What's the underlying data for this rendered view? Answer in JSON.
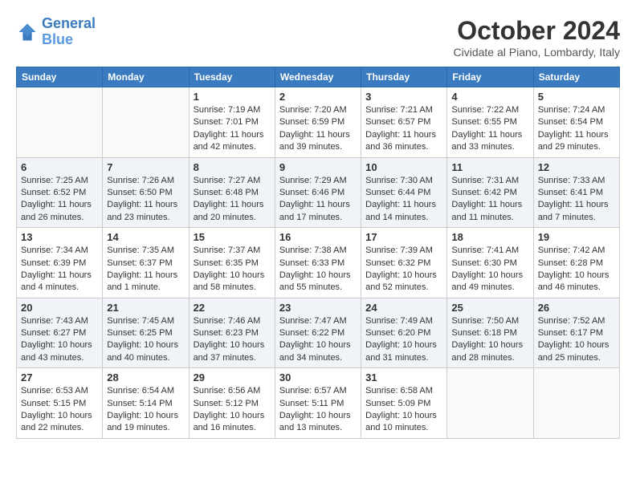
{
  "logo": {
    "line1": "General",
    "line2": "Blue"
  },
  "title": "October 2024",
  "subtitle": "Cividate al Piano, Lombardy, Italy",
  "headers": [
    "Sunday",
    "Monday",
    "Tuesday",
    "Wednesday",
    "Thursday",
    "Friday",
    "Saturday"
  ],
  "weeks": [
    [
      {
        "day": "",
        "info": ""
      },
      {
        "day": "",
        "info": ""
      },
      {
        "day": "1",
        "info": "Sunrise: 7:19 AM\nSunset: 7:01 PM\nDaylight: 11 hours and 42 minutes."
      },
      {
        "day": "2",
        "info": "Sunrise: 7:20 AM\nSunset: 6:59 PM\nDaylight: 11 hours and 39 minutes."
      },
      {
        "day": "3",
        "info": "Sunrise: 7:21 AM\nSunset: 6:57 PM\nDaylight: 11 hours and 36 minutes."
      },
      {
        "day": "4",
        "info": "Sunrise: 7:22 AM\nSunset: 6:55 PM\nDaylight: 11 hours and 33 minutes."
      },
      {
        "day": "5",
        "info": "Sunrise: 7:24 AM\nSunset: 6:54 PM\nDaylight: 11 hours and 29 minutes."
      }
    ],
    [
      {
        "day": "6",
        "info": "Sunrise: 7:25 AM\nSunset: 6:52 PM\nDaylight: 11 hours and 26 minutes."
      },
      {
        "day": "7",
        "info": "Sunrise: 7:26 AM\nSunset: 6:50 PM\nDaylight: 11 hours and 23 minutes."
      },
      {
        "day": "8",
        "info": "Sunrise: 7:27 AM\nSunset: 6:48 PM\nDaylight: 11 hours and 20 minutes."
      },
      {
        "day": "9",
        "info": "Sunrise: 7:29 AM\nSunset: 6:46 PM\nDaylight: 11 hours and 17 minutes."
      },
      {
        "day": "10",
        "info": "Sunrise: 7:30 AM\nSunset: 6:44 PM\nDaylight: 11 hours and 14 minutes."
      },
      {
        "day": "11",
        "info": "Sunrise: 7:31 AM\nSunset: 6:42 PM\nDaylight: 11 hours and 11 minutes."
      },
      {
        "day": "12",
        "info": "Sunrise: 7:33 AM\nSunset: 6:41 PM\nDaylight: 11 hours and 7 minutes."
      }
    ],
    [
      {
        "day": "13",
        "info": "Sunrise: 7:34 AM\nSunset: 6:39 PM\nDaylight: 11 hours and 4 minutes."
      },
      {
        "day": "14",
        "info": "Sunrise: 7:35 AM\nSunset: 6:37 PM\nDaylight: 11 hours and 1 minute."
      },
      {
        "day": "15",
        "info": "Sunrise: 7:37 AM\nSunset: 6:35 PM\nDaylight: 10 hours and 58 minutes."
      },
      {
        "day": "16",
        "info": "Sunrise: 7:38 AM\nSunset: 6:33 PM\nDaylight: 10 hours and 55 minutes."
      },
      {
        "day": "17",
        "info": "Sunrise: 7:39 AM\nSunset: 6:32 PM\nDaylight: 10 hours and 52 minutes."
      },
      {
        "day": "18",
        "info": "Sunrise: 7:41 AM\nSunset: 6:30 PM\nDaylight: 10 hours and 49 minutes."
      },
      {
        "day": "19",
        "info": "Sunrise: 7:42 AM\nSunset: 6:28 PM\nDaylight: 10 hours and 46 minutes."
      }
    ],
    [
      {
        "day": "20",
        "info": "Sunrise: 7:43 AM\nSunset: 6:27 PM\nDaylight: 10 hours and 43 minutes."
      },
      {
        "day": "21",
        "info": "Sunrise: 7:45 AM\nSunset: 6:25 PM\nDaylight: 10 hours and 40 minutes."
      },
      {
        "day": "22",
        "info": "Sunrise: 7:46 AM\nSunset: 6:23 PM\nDaylight: 10 hours and 37 minutes."
      },
      {
        "day": "23",
        "info": "Sunrise: 7:47 AM\nSunset: 6:22 PM\nDaylight: 10 hours and 34 minutes."
      },
      {
        "day": "24",
        "info": "Sunrise: 7:49 AM\nSunset: 6:20 PM\nDaylight: 10 hours and 31 minutes."
      },
      {
        "day": "25",
        "info": "Sunrise: 7:50 AM\nSunset: 6:18 PM\nDaylight: 10 hours and 28 minutes."
      },
      {
        "day": "26",
        "info": "Sunrise: 7:52 AM\nSunset: 6:17 PM\nDaylight: 10 hours and 25 minutes."
      }
    ],
    [
      {
        "day": "27",
        "info": "Sunrise: 6:53 AM\nSunset: 5:15 PM\nDaylight: 10 hours and 22 minutes."
      },
      {
        "day": "28",
        "info": "Sunrise: 6:54 AM\nSunset: 5:14 PM\nDaylight: 10 hours and 19 minutes."
      },
      {
        "day": "29",
        "info": "Sunrise: 6:56 AM\nSunset: 5:12 PM\nDaylight: 10 hours and 16 minutes."
      },
      {
        "day": "30",
        "info": "Sunrise: 6:57 AM\nSunset: 5:11 PM\nDaylight: 10 hours and 13 minutes."
      },
      {
        "day": "31",
        "info": "Sunrise: 6:58 AM\nSunset: 5:09 PM\nDaylight: 10 hours and 10 minutes."
      },
      {
        "day": "",
        "info": ""
      },
      {
        "day": "",
        "info": ""
      }
    ]
  ]
}
